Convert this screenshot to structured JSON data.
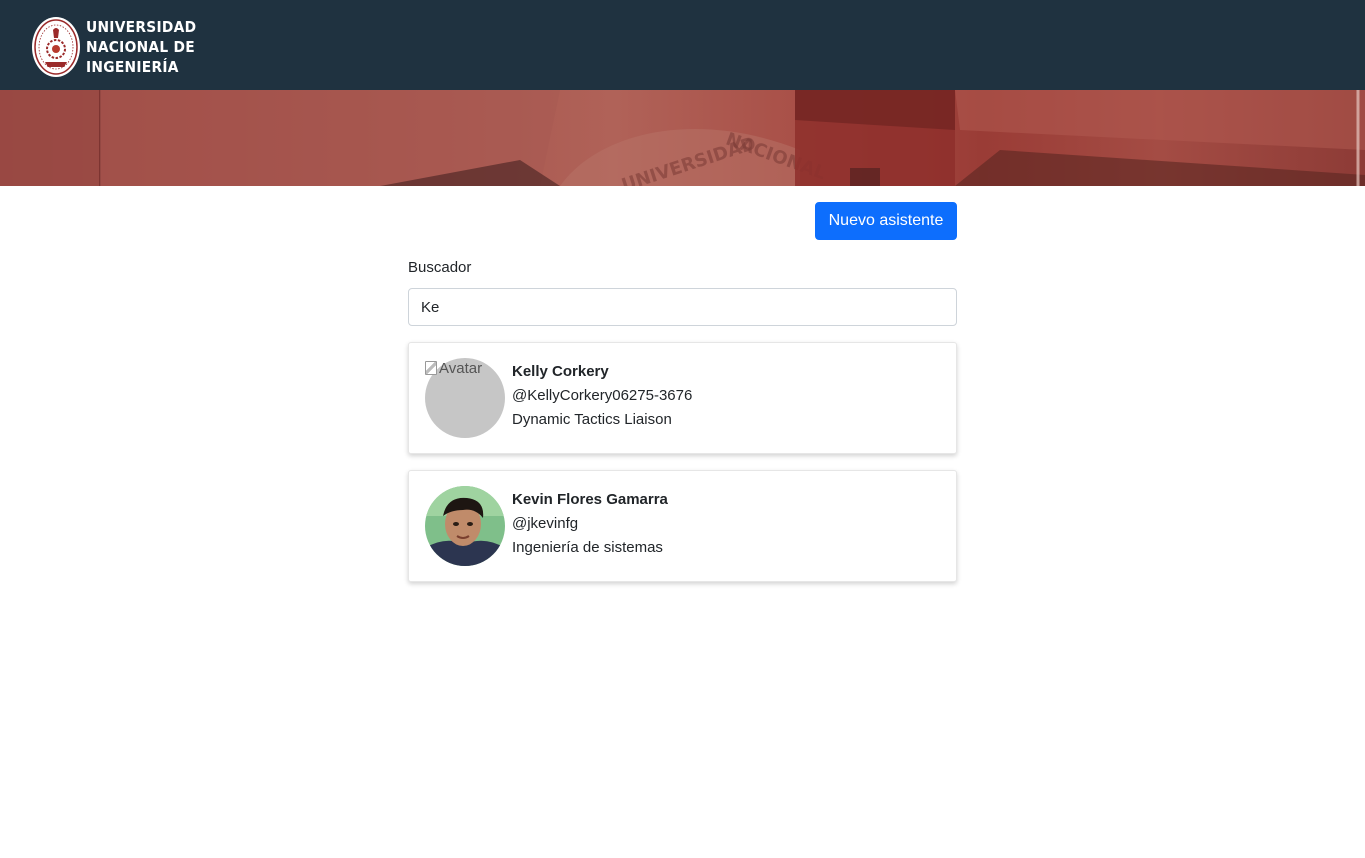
{
  "header": {
    "logo_lines": [
      "UNIVERSIDAD",
      "NACIONAL DE",
      "INGENIERÍA"
    ]
  },
  "toolbar": {
    "new_button_label": "Nuevo asistente"
  },
  "search": {
    "label": "Buscador",
    "value": "Ke"
  },
  "results": [
    {
      "name": "Kelly Corkery",
      "handle": "@KellyCorkery06275-3676",
      "role": "Dynamic Tactics Liaison",
      "avatar_alt": "Avatar"
    },
    {
      "name": "Kevin Flores Gamarra",
      "handle": "@jkevinfg",
      "role": "Ingeniería de sistemas"
    }
  ]
}
